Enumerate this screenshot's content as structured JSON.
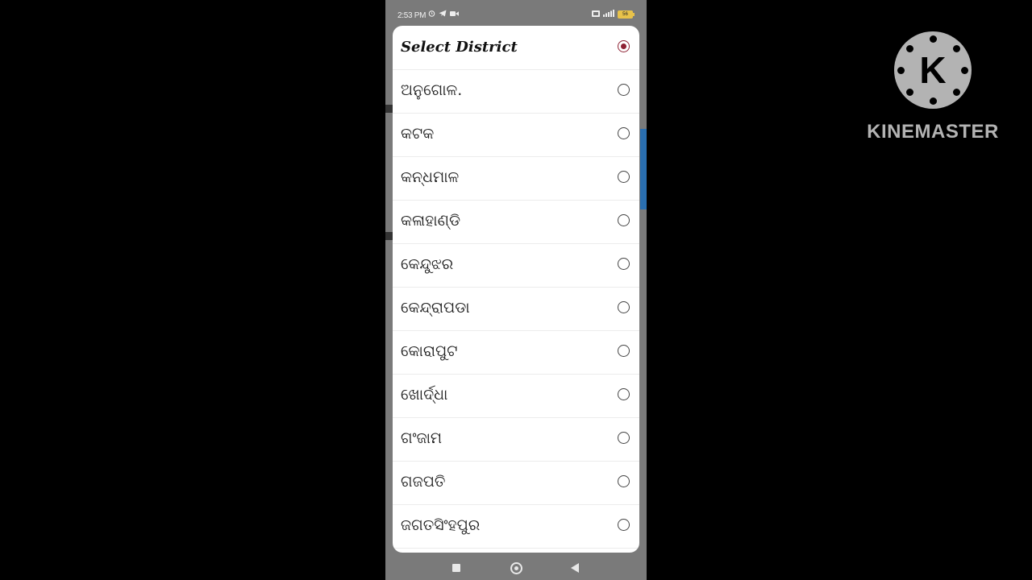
{
  "status_bar": {
    "time": "2:53 PM",
    "battery": "56",
    "icons_left": [
      "alarm-icon",
      "telegram-icon",
      "video-camera-icon"
    ],
    "icons_right": [
      "volte-icon",
      "signal-icon",
      "battery-icon"
    ]
  },
  "dialog": {
    "title": "Select District",
    "accent_color": "#8e2234",
    "items": [
      {
        "label": "ଅନୁଗୋଳ.",
        "selected": false
      },
      {
        "label": "କଟକ",
        "selected": false
      },
      {
        "label": "କନ୍ଧମାଳ",
        "selected": false
      },
      {
        "label": "କଳାହାଣ୍ଡି",
        "selected": false
      },
      {
        "label": "କେନ୍ଦୁଝର",
        "selected": false
      },
      {
        "label": "କେନ୍ଦ୍ରାପଡା",
        "selected": false
      },
      {
        "label": "କୋରାପୁଟ",
        "selected": false
      },
      {
        "label": "ଖୋର୍ଦ୍ଧା",
        "selected": false
      },
      {
        "label": "ଗଂଜାମ",
        "selected": false
      },
      {
        "label": "ଗଜପତି",
        "selected": false
      },
      {
        "label": "ଜଗତସିଂହପୁର",
        "selected": false
      }
    ]
  },
  "nav_bar": {
    "buttons": [
      "recents-button",
      "home-button",
      "back-button"
    ]
  },
  "watermark": {
    "logo_letter": "K",
    "text": "KINEMASTER"
  }
}
